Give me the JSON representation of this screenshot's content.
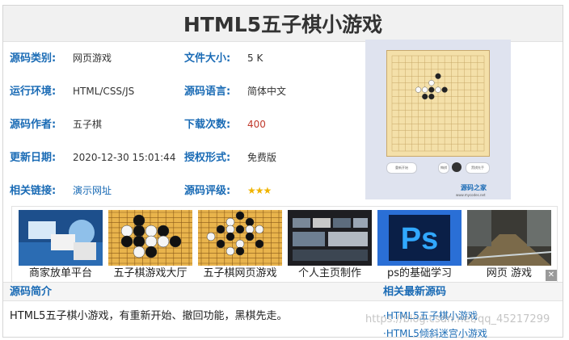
{
  "page": {
    "title": "HTML5五子棋小游戏"
  },
  "info": [
    {
      "label": "源码类别:",
      "value": "网页游戏",
      "label2": "文件大小:",
      "value2": "5 K"
    },
    {
      "label": "运行环境:",
      "value": "HTML/CSS/JS",
      "label2": "源码语言:",
      "value2": "简体中文"
    },
    {
      "label": "源码作者:",
      "value": "五子棋",
      "label2": "下载次数:",
      "value2": "400"
    },
    {
      "label": "更新日期:",
      "value": "2020-12-30 15:01:44",
      "label2": "授权形式:",
      "value2": "免费版"
    },
    {
      "label": "相关链接:",
      "value": "演示网址",
      "label2": "源码评级:",
      "value2": "★★★"
    }
  ],
  "preview": {
    "btn_restart": "重新开始",
    "btn_undo": "悔棋",
    "btn_black": "",
    "btn_black_first": "黑棋先手",
    "logo": "源码之家",
    "url": "www.mycodes.net"
  },
  "thumbs": [
    {
      "caption": "商家放单平台"
    },
    {
      "caption": "五子棋游戏大厅"
    },
    {
      "caption": "五子棋网页游戏"
    },
    {
      "caption": "个人主页制作"
    },
    {
      "caption": "ps的基础学习"
    },
    {
      "caption": "网页 游戏"
    }
  ],
  "close_glyph": "✕",
  "sections": {
    "intro_title": "源码简介",
    "intro_text": "HTML5五子棋小游戏，有重新开始、撤回功能，黑棋先走。",
    "recent_title": "相关最新源码",
    "recent_items": [
      "·HTML5五子棋小游戏",
      "·HTML5倾斜迷宫小游戏"
    ]
  },
  "watermark": "https://blog.csdn.net/qq_45217299"
}
